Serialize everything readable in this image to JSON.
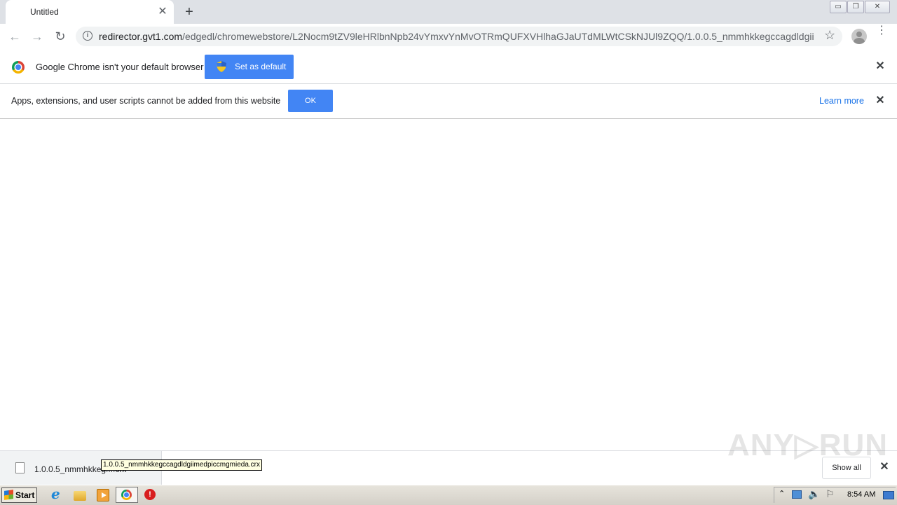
{
  "tab": {
    "title": "Untitled",
    "close_glyph": "✕",
    "new_tab_glyph": "+"
  },
  "window_controls": {
    "minimize": "▭",
    "restore": "❐",
    "close": "✕"
  },
  "toolbar": {
    "back_glyph": "←",
    "forward_glyph": "→",
    "reload_glyph": "↻",
    "info_glyph": "i",
    "url_host": "redirector.gvt1.com",
    "url_path": "/edgedl/chromewebstore/L2Nocm9tZV9leHRlbnNpb24vYmxvYnMvOTRmQUFXVHlhaGJaUTdMLWtCSkNJUl9ZQQ/1.0.0.5_nmmhkkegccagdldgiim...",
    "star_glyph": "☆",
    "menu_glyph": "⋮"
  },
  "infobar_default": {
    "message": "Google Chrome isn't your default browser",
    "button_label": "Set as default",
    "close_glyph": "✕"
  },
  "infobar_extensions": {
    "message": "Apps, extensions, and user scripts cannot be added from this website",
    "ok_label": "OK",
    "learn_more": "Learn more",
    "close_glyph": "✕"
  },
  "download_shelf": {
    "file_name": "1.0.0.5_nmmhkkeg....crx",
    "tooltip": "1.0.0.5_nmmhkkegccagdldgiimedpiccmgmieda.crx",
    "watermark": "ANY▷RUN",
    "show_all": "Show all",
    "close_glyph": "✕"
  },
  "taskbar": {
    "start_label": "Start",
    "stop_glyph": "!",
    "tray_arrow": "⌃",
    "volume_glyph": "🔈",
    "flag_glyph": "⚐",
    "clock": "8:54 AM"
  },
  "colors": {
    "accent": "#4285f4",
    "link": "#1a73e8",
    "tab_strip": "#dee1e6"
  }
}
